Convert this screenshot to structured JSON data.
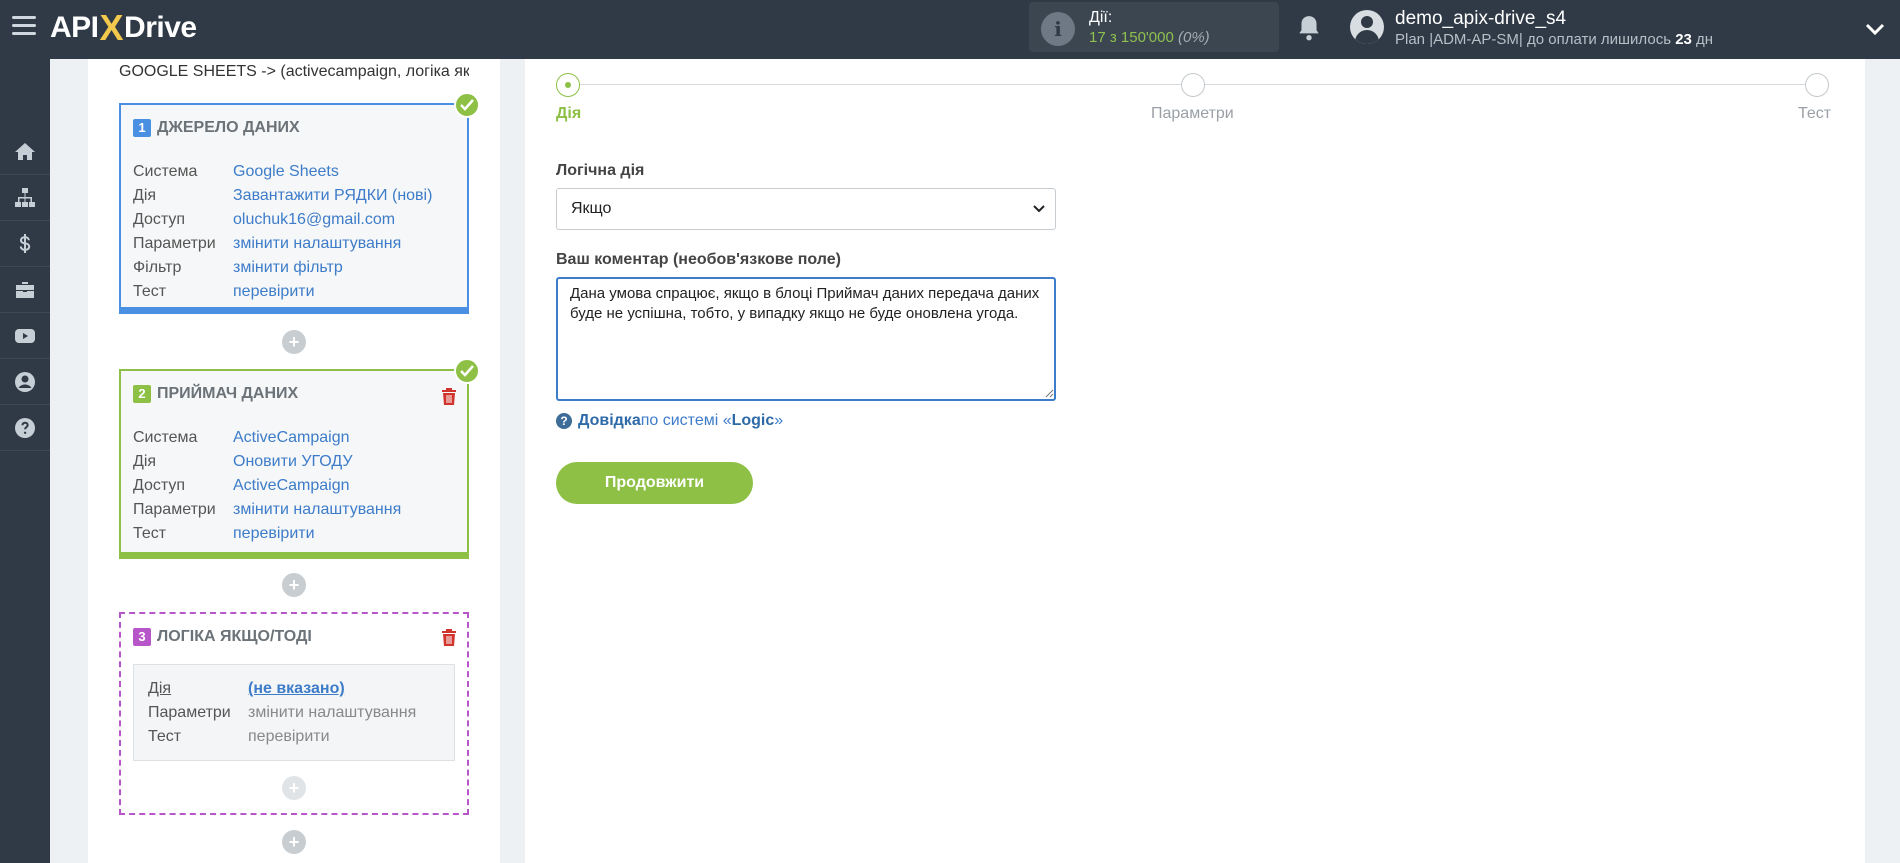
{
  "header": {
    "logo_prefix": "API",
    "logo_x": "X",
    "logo_suffix": "Drive",
    "actions_label": "Дії:",
    "actions_used": "17",
    "actions_of": " з 150'000 ",
    "actions_pct": "(0%)",
    "user_name": "demo_apix-drive_s4",
    "plan_text": "Plan |ADM-AP-SM| до оплати лишилось ",
    "plan_days": "23",
    "plan_unit": " дн"
  },
  "sidebar": {
    "items": [
      {
        "icon": "home-icon"
      },
      {
        "icon": "sitemap-icon"
      },
      {
        "icon": "dollar-icon"
      },
      {
        "icon": "briefcase-icon"
      },
      {
        "icon": "youtube-icon"
      },
      {
        "icon": "user-circle-icon"
      },
      {
        "icon": "help-circle-icon"
      }
    ]
  },
  "breadcrumb": "GOOGLE SHEETS -> (activecampaign, логіка які",
  "source": {
    "number": "1",
    "title": "ДЖЕРЕЛО ДАНИХ",
    "rows": [
      {
        "key": "Система",
        "value": "Google Sheets"
      },
      {
        "key": "Дія",
        "value": "Завантажити РЯДКИ (нові)"
      },
      {
        "key": "Доступ",
        "value": "oluchuk16@gmail.com"
      },
      {
        "key": "Параметри",
        "value": "змінити налаштування"
      },
      {
        "key": "Фільтр",
        "value": "змінити фільтр"
      },
      {
        "key": "Тест",
        "value": "перевірити"
      }
    ]
  },
  "destination": {
    "number": "2",
    "title": "ПРИЙМАЧ ДАНИХ",
    "rows": [
      {
        "key": "Система",
        "value": "ActiveCampaign"
      },
      {
        "key": "Дія",
        "value": "Оновити УГОДУ"
      },
      {
        "key": "Доступ",
        "value": "ActiveCampaign"
      },
      {
        "key": "Параметри",
        "value": "змінити налаштування"
      },
      {
        "key": "Тест",
        "value": "перевірити"
      }
    ]
  },
  "logic": {
    "number": "3",
    "title": "ЛОГІКА ЯКЩО/ТОДІ",
    "rows": [
      {
        "key": "Дія",
        "value": "(не вказано)"
      },
      {
        "key": "Параметри",
        "value": "змінити налаштування"
      },
      {
        "key": "Тест",
        "value": "перевірити"
      }
    ]
  },
  "plus_label": "+",
  "steps": [
    {
      "label": "Дія",
      "active": true
    },
    {
      "label": "Параметри",
      "active": false
    },
    {
      "label": "Тест",
      "active": false
    }
  ],
  "form": {
    "logic_action_label": "Логічна дія",
    "logic_action_value": "Якщо",
    "comment_label": "Ваш коментар (необов'язкове поле)",
    "comment_value": "Дана умова спрацює, якщо в блоці Приймач даних передача даних буде не успішна, тобто, у випадку якщо не буде оновлена угода.",
    "help_link": "Довідка",
    "help_mid": " по системі «",
    "help_system": "Logic",
    "help_end": "»",
    "continue_label": "Продовжити"
  },
  "colors": {
    "topbar": "#2f3a46",
    "accent_green": "#8dc045",
    "accent_blue": "#4a90e2",
    "accent_purple": "#b756c9",
    "link": "#3d7cc9"
  }
}
